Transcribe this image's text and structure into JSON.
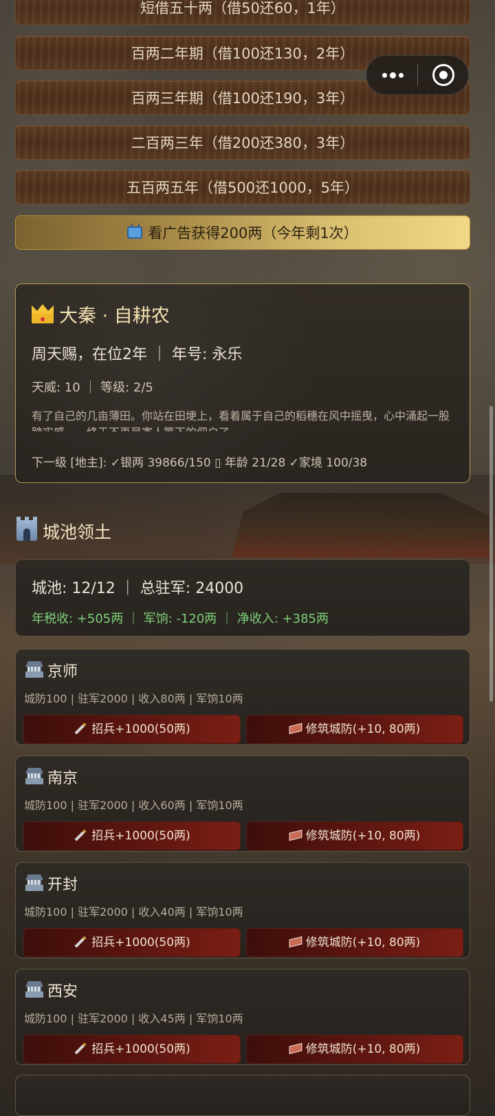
{
  "loans": [
    "短借五十两（借50还60，1年）",
    "百两二年期（借100还130，2年）",
    "百两三年期（借100还190，3年）",
    "二百两三年（借200还380，3年）",
    "五百两五年（借500还1000，5年）"
  ],
  "ad_button": {
    "icon": "tv-icon",
    "label": "看广告获得200两（今年剩1次）"
  },
  "dynasty": {
    "title": "大秦 · 自耕农",
    "ruler": "周天赐，在位2年 ｜ 年号: 永乐",
    "stats": "天威: 10 ｜ 等级: 2/5",
    "description": "有了自己的几亩薄田。你站在田埂上，看着属于自己的稻穗在风中摇曳，心中涌起一股踏实感——终于不再是寄人篱下的佃户了。",
    "next_level": "下一级 [地主]: ✓银两 39866/150  ▯  年龄 21/28  ✓家境 100/38"
  },
  "section": {
    "icon": "castle-icon",
    "title": "城池领土"
  },
  "summary": {
    "line1": "城池: 12/12 ｜ 总驻军: 24000",
    "line2": "年税收: +505两 ｜ 军饷: -120两 ｜ 净收入: +385两"
  },
  "cities": [
    {
      "name": "京师",
      "stats": "城防100 | 驻军2000 | 收入80两 | 军饷10两",
      "recruit": "招兵+1000(50两)",
      "fortify": "修筑城防(+10, 80两)"
    },
    {
      "name": "南京",
      "stats": "城防100 | 驻军2000 | 收入60两 | 军饷10两",
      "recruit": "招兵+1000(50两)",
      "fortify": "修筑城防(+10, 80两)"
    },
    {
      "name": "开封",
      "stats": "城防100 | 驻军2000 | 收入40两 | 军饷10两",
      "recruit": "招兵+1000(50两)",
      "fortify": "修筑城防(+10, 80两)"
    },
    {
      "name": "西安",
      "stats": "城防100 | 驻军2000 | 收入45两 | 军饷10两",
      "recruit": "招兵+1000(50两)",
      "fortify": "修筑城防(+10, 80两)"
    }
  ],
  "colors": {
    "gold": "#f0d888",
    "income_green": "#7fcf7a",
    "button_red": "#5b1510",
    "wood": "#5d3b22"
  }
}
